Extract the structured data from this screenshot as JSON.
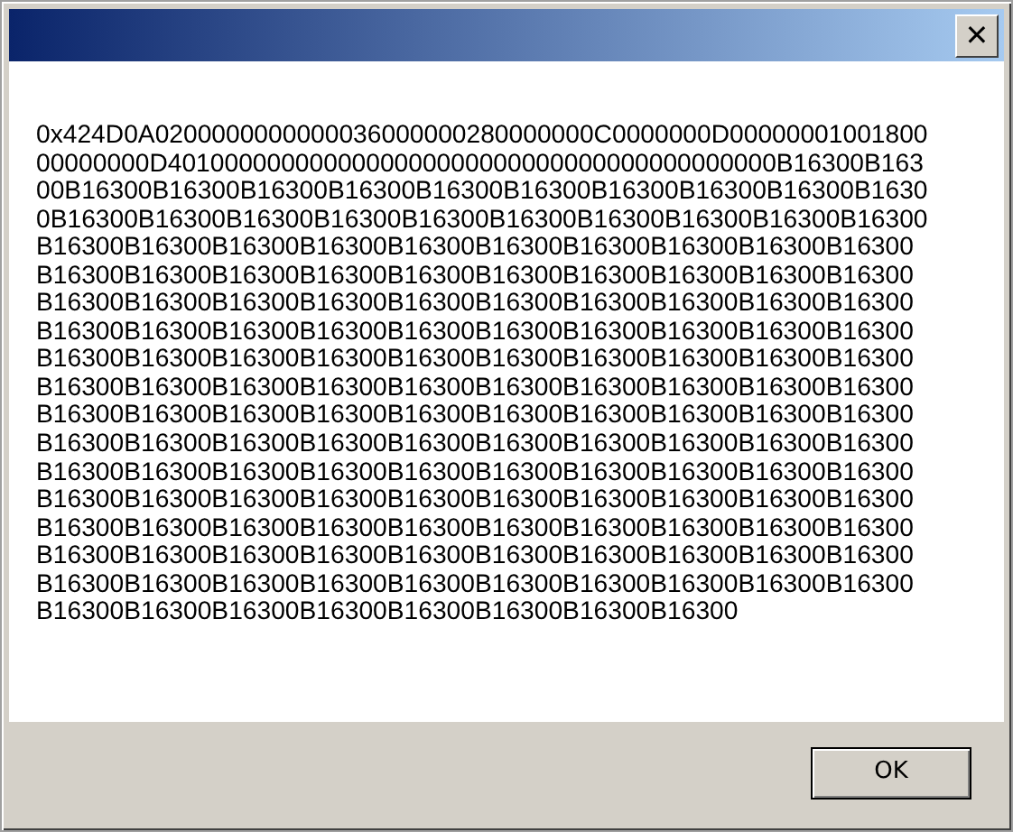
{
  "message": "0x424D0A0200000000000036000000280000000C0000000D0000000100180000000000D4010000000000000000000000000000000000000000B16300B16300B16300B16300B16300B16300B16300B16300B16300B16300B16300B16300B16300B16300B16300B16300B16300B16300B16300B16300B16300B16300B16300B16300B16300B16300B16300B16300B16300B16300B16300B16300B16300B16300B16300B16300B16300B16300B16300B16300B16300B16300B16300B16300B16300B16300B16300B16300B16300B16300B16300B16300B16300B16300B16300B16300B16300B16300B16300B16300B16300B16300B16300B16300B16300B16300B16300B16300B16300B16300B16300B16300B16300B16300B16300B16300B16300B16300B16300B16300B16300B16300B16300B16300B16300B16300B16300B16300B16300B16300B16300B16300B16300B16300B16300B16300B16300B16300B16300B16300B16300B16300B16300B16300B16300B16300B16300B16300B16300B16300B16300B16300B16300B16300B16300B16300B16300B16300B16300B16300B16300B16300B16300B16300B16300B16300B16300B16300B16300B16300B16300B16300B16300B16300B16300B16300B16300B16300B16300B16300B16300B16300B16300B16300B16300B16300B16300B16300B16300B16300B16300B16300B16300B16300B16300B16300B16300B16300B16300B16300",
  "close": "✕",
  "buttons": [
    "OK"
  ]
}
